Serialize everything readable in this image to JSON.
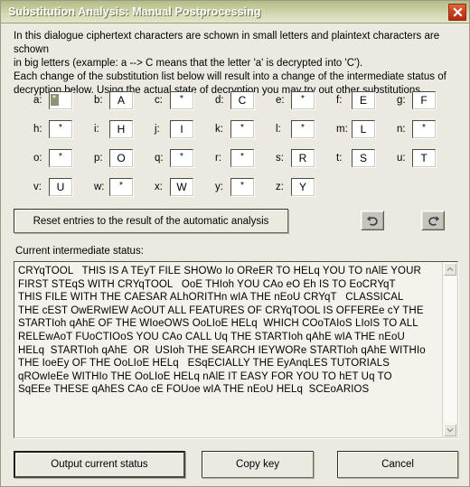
{
  "window": {
    "title": "Substitution Analysis: Manual Postprocessing",
    "close_icon": "close-icon",
    "titlebar_color": "#c3c999",
    "accent_close_color": "#d2401c",
    "background_color": "#ece9e0"
  },
  "description": {
    "line1": "In this dialogue ciphertext characters are schown in small letters and plaintext characters are schown",
    "line2": "in big letters (example: a --> C means that the letter 'a' is decrypted into 'C').",
    "line3": "Each change of the substitution list below will result into a change of the intermediate status of",
    "line4": "decryption below. Using the actual state of decryption you may try out other substitutions."
  },
  "substitution": {
    "rows": [
      [
        {
          "cipher": "a:",
          "plain": "*",
          "selected": true
        },
        {
          "cipher": "b:",
          "plain": "A",
          "selected": false
        },
        {
          "cipher": "c:",
          "plain": "*",
          "selected": false
        },
        {
          "cipher": "d:",
          "plain": "C",
          "selected": false
        },
        {
          "cipher": "e:",
          "plain": "*",
          "selected": false
        },
        {
          "cipher": "f:",
          "plain": "E",
          "selected": false
        },
        {
          "cipher": "g:",
          "plain": "F",
          "selected": false
        }
      ],
      [
        {
          "cipher": "h:",
          "plain": "*",
          "selected": false
        },
        {
          "cipher": "i:",
          "plain": "H",
          "selected": false
        },
        {
          "cipher": "j:",
          "plain": "I",
          "selected": false
        },
        {
          "cipher": "k:",
          "plain": "*",
          "selected": false
        },
        {
          "cipher": "l:",
          "plain": "*",
          "selected": false
        },
        {
          "cipher": "m:",
          "plain": "L",
          "selected": false
        },
        {
          "cipher": "n:",
          "plain": "*",
          "selected": false
        }
      ],
      [
        {
          "cipher": "o:",
          "plain": "*",
          "selected": false
        },
        {
          "cipher": "p:",
          "plain": "O",
          "selected": false
        },
        {
          "cipher": "q:",
          "plain": "*",
          "selected": false
        },
        {
          "cipher": "r:",
          "plain": "*",
          "selected": false
        },
        {
          "cipher": "s:",
          "plain": "R",
          "selected": false
        },
        {
          "cipher": "t:",
          "plain": "S",
          "selected": false
        },
        {
          "cipher": "u:",
          "plain": "T",
          "selected": false
        }
      ],
      [
        {
          "cipher": "v:",
          "plain": "U",
          "selected": false
        },
        {
          "cipher": "w:",
          "plain": "*",
          "selected": false
        },
        {
          "cipher": "x:",
          "plain": "W",
          "selected": false
        },
        {
          "cipher": "y:",
          "plain": "*",
          "selected": false
        },
        {
          "cipher": "z:",
          "plain": "Y",
          "selected": false
        }
      ]
    ]
  },
  "toolbar": {
    "reset_label": "Reset entries to the result of the automatic analysis",
    "undo_icon": "undo-icon",
    "redo_icon": "redo-icon"
  },
  "status": {
    "label": "Current intermediate status:",
    "text": "CRYqTOOL   THIS IS A TEyT FILE SHOWo Io OReER TO HELq YOU TO nAlE YOUR\nFIRST STEqS WITH CRYqTOOL   OoE THIoh YOU CAo eO Eh IS TO EoCRYqT\nTHIS FILE WITH THE CAESAR ALhORITHn wIA THE nEoU CRYqT   CLASSICAL\nTHE cEST OwERwIEW AcOUT ALL FEATURES OF CRYqTOOL IS OFFEREe cY THE\nSTARTIoh qAhE OF THE WIoeOWS OoLIoE HELq  WHICH COoTAIoS LIoIS TO ALL\nRELEwAoT FUoCTIOoS YOU CAo CALL Uq THE STARTIoh qAhE wIA THE nEoU\nHELq  STARTIoh qAhE  OR  USIoh THE SEARCH IEYWORe STARTIoh qAhE WITHIo\nTHE IoeEy OF THE OoLIoE HELq   ESqECIALLY THE EyAnqLES TUTORIALS\nqROwIeEe WITHIo THE OoLIoE HELq nAlE IT EASY FOR YOU TO hET Uq TO\nSqEEe THESE qAhES CAo cE FOUoe wIA THE nEoU HELq  SCEoARIOS",
    "scroll_up_icon": "chevron-up-icon",
    "scroll_down_icon": "chevron-down-icon"
  },
  "footer": {
    "output_label": "Output current status",
    "copy_label": "Copy key",
    "cancel_label": "Cancel"
  }
}
